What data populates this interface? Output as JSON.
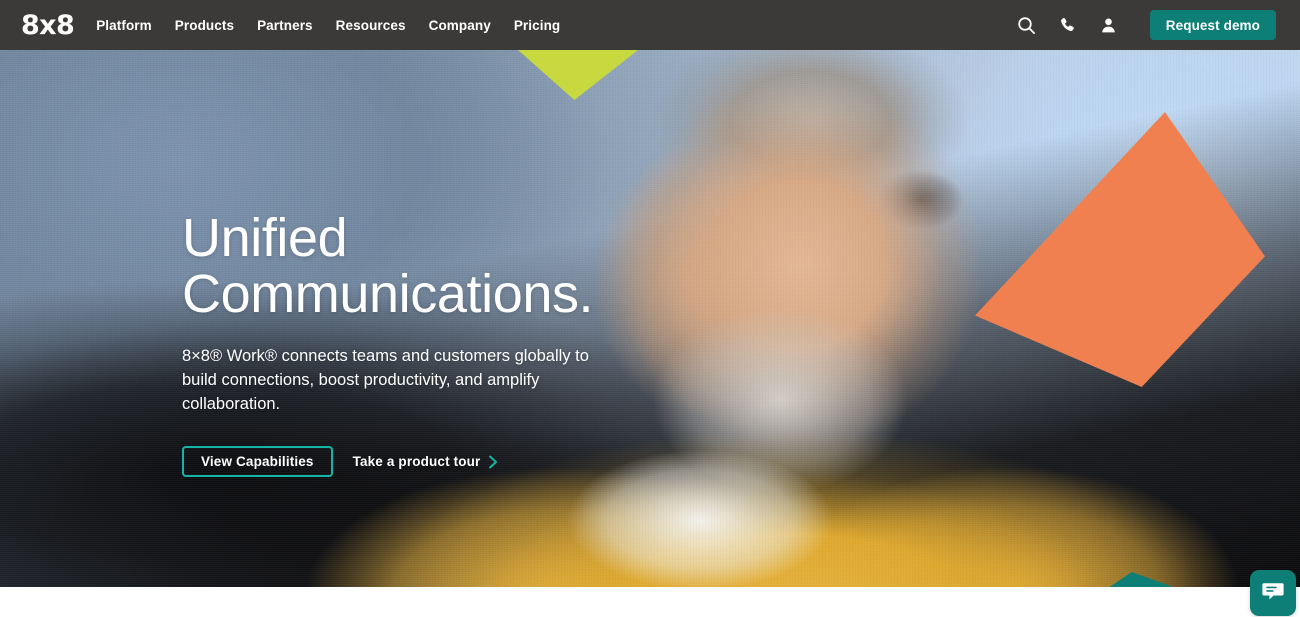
{
  "navbar": {
    "logo": "8x8",
    "links": [
      {
        "label": "Platform"
      },
      {
        "label": "Products"
      },
      {
        "label": "Partners"
      },
      {
        "label": "Resources"
      },
      {
        "label": "Company"
      },
      {
        "label": "Pricing"
      }
    ],
    "icons": [
      {
        "name": "search-icon"
      },
      {
        "name": "phone-icon"
      },
      {
        "name": "user-account-icon"
      }
    ],
    "cta_label": "Request demo",
    "background_color": "#3B3A38",
    "cta_color": "#0E7F76"
  },
  "hero": {
    "title_line1": "Unified",
    "title_line2": "Communications.",
    "subtitle": "8×8® Work® connects teams and customers globally to build connections, boost productivity, and amplify collaboration.",
    "primary_cta": "View Capabilities",
    "secondary_cta": "Take a product tour",
    "secondary_cta_icon": "chevron-right-icon",
    "primary_cta_border_color": "#14B5A6"
  },
  "decorations": {
    "lime_triangle_color": "#C8D93F",
    "orange_quad_color": "#F08050",
    "teal_triangle_color": "#0E7F76",
    "lime_bottom_color": "#C8D93F",
    "line_color": "#2E2A26"
  },
  "chat": {
    "icon": "chat-bubble-icon",
    "background_color": "#0E7F76"
  }
}
